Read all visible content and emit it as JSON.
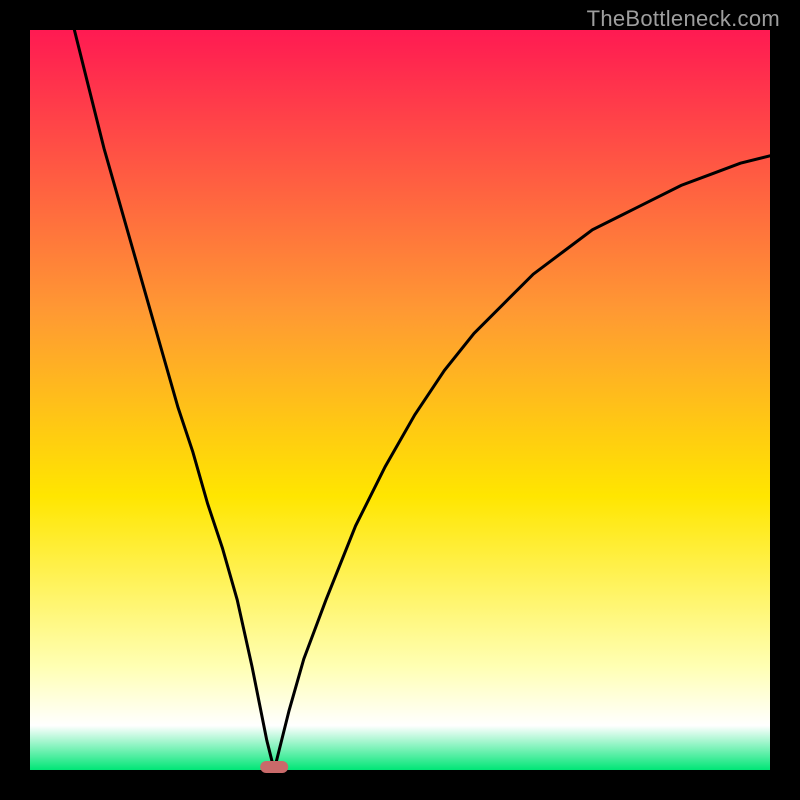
{
  "watermark": "TheBottleneck.com",
  "chart_data": {
    "type": "line",
    "title": "",
    "xlabel": "",
    "ylabel": "",
    "xlim": [
      0,
      100
    ],
    "ylim": [
      0,
      100
    ],
    "background_gradient": {
      "top": "#ff1a52",
      "mid1": "#ff9933",
      "mid2": "#ffe600",
      "low1": "#ffffb3",
      "low2": "#ffffff",
      "bottom": "#00e676"
    },
    "minimum_x": 33,
    "marker": {
      "x": 33,
      "y": 0,
      "color": "#c96a6a"
    },
    "series": [
      {
        "name": "bottleneck-curve",
        "color": "#000000",
        "x": [
          6,
          8,
          10,
          12,
          14,
          16,
          18,
          20,
          22,
          24,
          26,
          28,
          30,
          31,
          32,
          33,
          34,
          35,
          37,
          40,
          44,
          48,
          52,
          56,
          60,
          64,
          68,
          72,
          76,
          80,
          84,
          88,
          92,
          96,
          100
        ],
        "y": [
          100,
          92,
          84,
          77,
          70,
          63,
          56,
          49,
          43,
          36,
          30,
          23,
          14,
          9,
          4,
          0,
          4,
          8,
          15,
          23,
          33,
          41,
          48,
          54,
          59,
          63,
          67,
          70,
          73,
          75,
          77,
          79,
          80.5,
          82,
          83
        ]
      }
    ]
  }
}
